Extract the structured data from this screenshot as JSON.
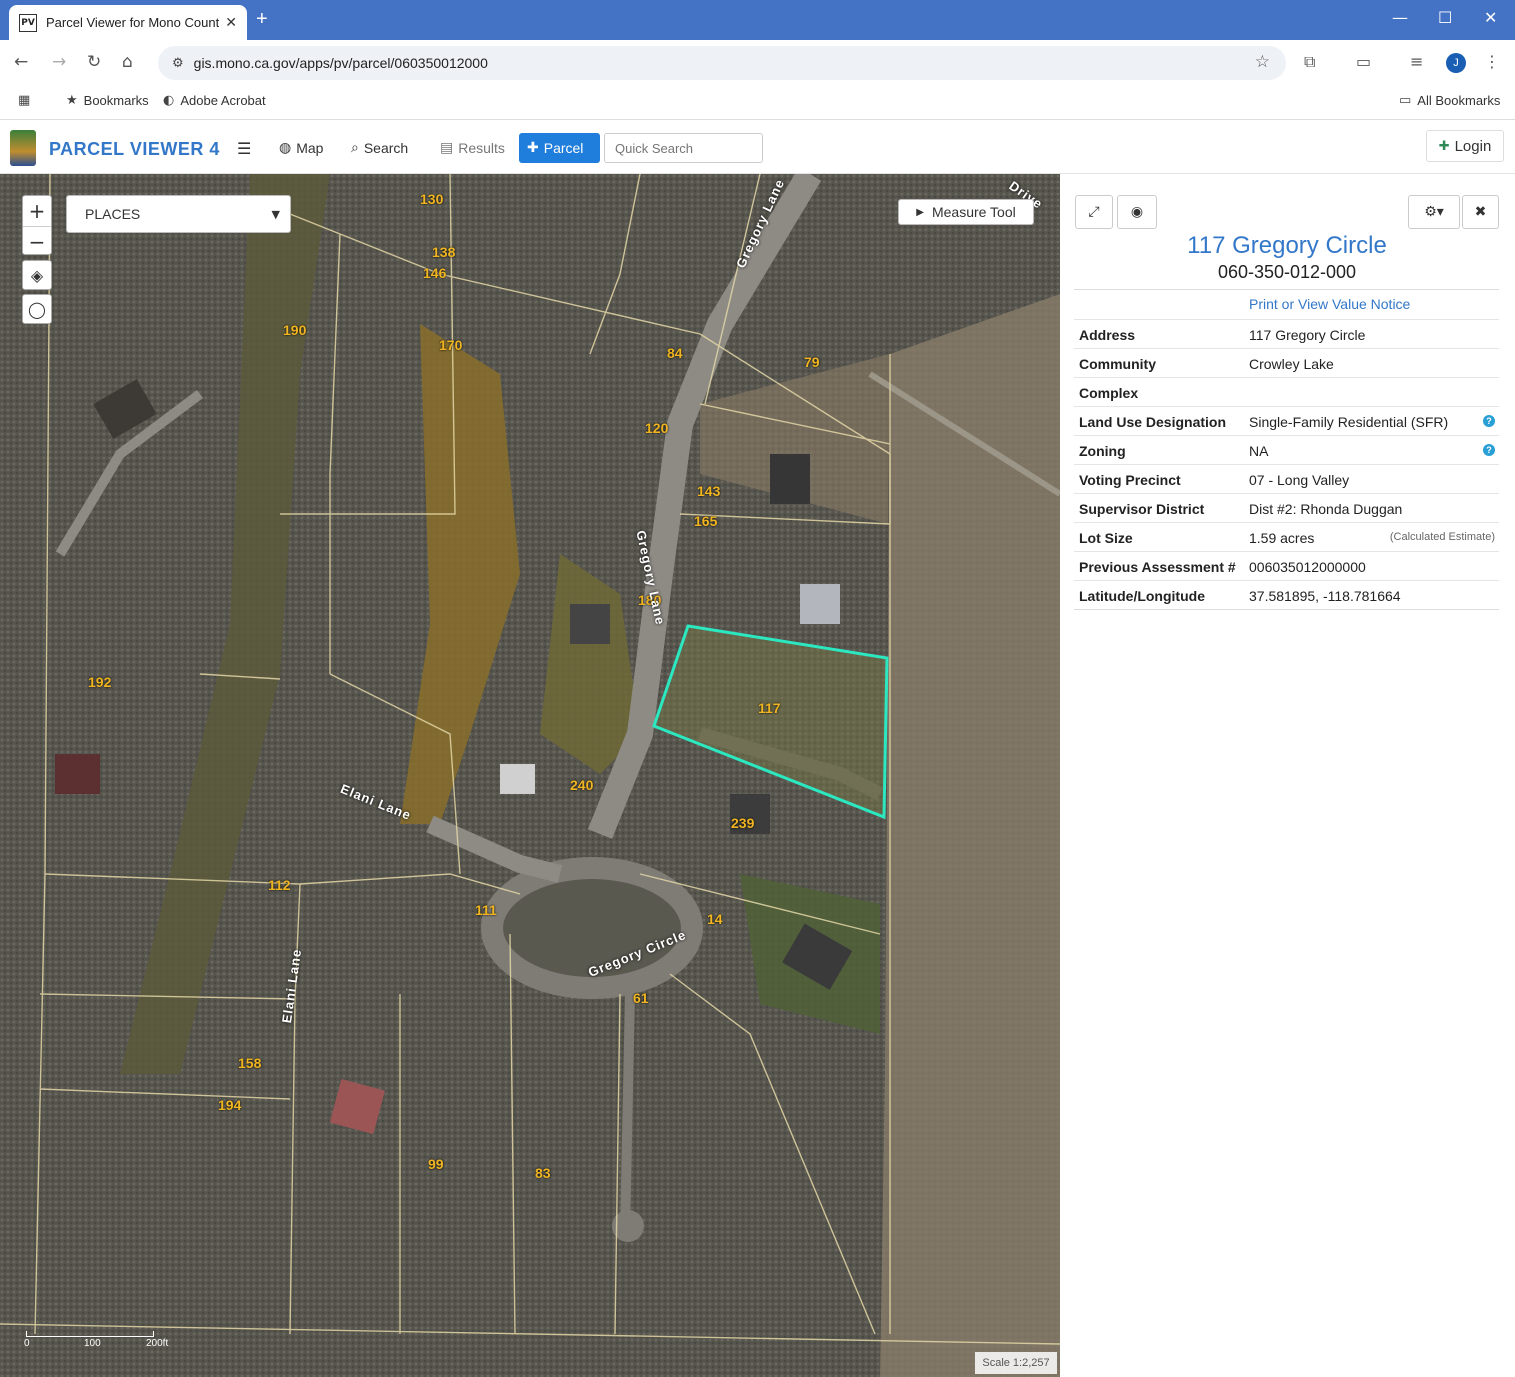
{
  "browser": {
    "tab_title": "Parcel Viewer for Mono County",
    "favicon": "PV",
    "url": "gis.mono.ca.gov/apps/pv/parcel/060350012000",
    "bookmarks": {
      "item1": "Bookmarks",
      "item2": "Adobe Acrobat",
      "all": "All Bookmarks"
    },
    "avatar_initial": "J"
  },
  "app": {
    "title": "PARCEL VIEWER 4",
    "nav": {
      "map": "Map",
      "search": "Search",
      "results": "Results",
      "parcel": "Parcel"
    },
    "quick_search_placeholder": "Quick Search",
    "login": "Login"
  },
  "map": {
    "places_select": "PLACES",
    "measure_tool": "Measure Tool",
    "scale_text": "Scale 1:2,257",
    "scale_labels": [
      "0",
      "100",
      "200ft"
    ],
    "parcel_labels": [
      "130",
      "138",
      "146",
      "190",
      "170",
      "84",
      "79",
      "120",
      "143",
      "165",
      "180",
      "117",
      "192",
      "240",
      "239",
      "112",
      "111",
      "14",
      "61",
      "158",
      "194",
      "99",
      "83"
    ],
    "road_labels": {
      "gregory_lane": "Gregory Lane",
      "elani_lane_top": "Elani Lane",
      "elani_lane_side": "Elani Lane",
      "gregory_circle": "Gregory Circle",
      "drive": "Drive",
      "gregory_lane_top": "Gregory Lane"
    },
    "selected_parcel_color": "#2be8c0"
  },
  "panel": {
    "title": "117 Gregory Circle",
    "apn": "060-350-012-000",
    "value_notice_link": "Print or View Value Notice",
    "rows": [
      {
        "label": "Address",
        "value": "117 Gregory Circle"
      },
      {
        "label": "Community",
        "value": "Crowley Lake"
      },
      {
        "label": "Complex",
        "value": ""
      },
      {
        "label": "Land Use Designation",
        "value": "Single-Family Residential (SFR)"
      },
      {
        "label": "Zoning",
        "value": "NA"
      },
      {
        "label": "Voting Precinct",
        "value": "07 - Long Valley"
      },
      {
        "label": "Supervisor District",
        "value": "Dist #2: Rhonda Duggan"
      },
      {
        "label": "Lot Size",
        "value": "1.59 acres"
      },
      {
        "label": "Previous Assessment #",
        "value": "006035012000000"
      },
      {
        "label": "Latitude/Longitude",
        "value": "37.581895, -118.781664"
      }
    ],
    "lot_size_note": "(Calculated Estimate)",
    "help_glyph": "?"
  }
}
